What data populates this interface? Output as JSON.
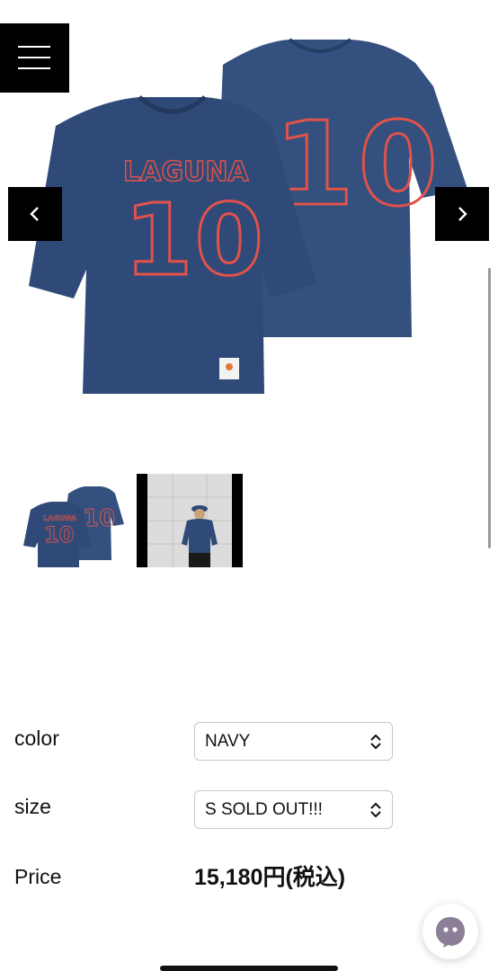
{
  "gallery": {
    "main_image": "laguna-10-navy-football-tee-front-back",
    "jersey_text": "LAGUNA",
    "jersey_number": "10",
    "shirt_color": "#2f4a78",
    "print_color": "#e0524a",
    "thumbnails": [
      "laguna-10-tee-product",
      "model-wearing-tee"
    ]
  },
  "options": {
    "color": {
      "label": "color",
      "value": "NAVY"
    },
    "size": {
      "label": "size",
      "value": "S SOLD OUT!!!"
    }
  },
  "price": {
    "label": "Price",
    "value": "15,180円(税込)"
  },
  "icons": {
    "menu": "hamburger-menu-icon",
    "prev": "chevron-left-icon",
    "next": "chevron-right-icon",
    "chat": "chat-ghost-icon"
  }
}
